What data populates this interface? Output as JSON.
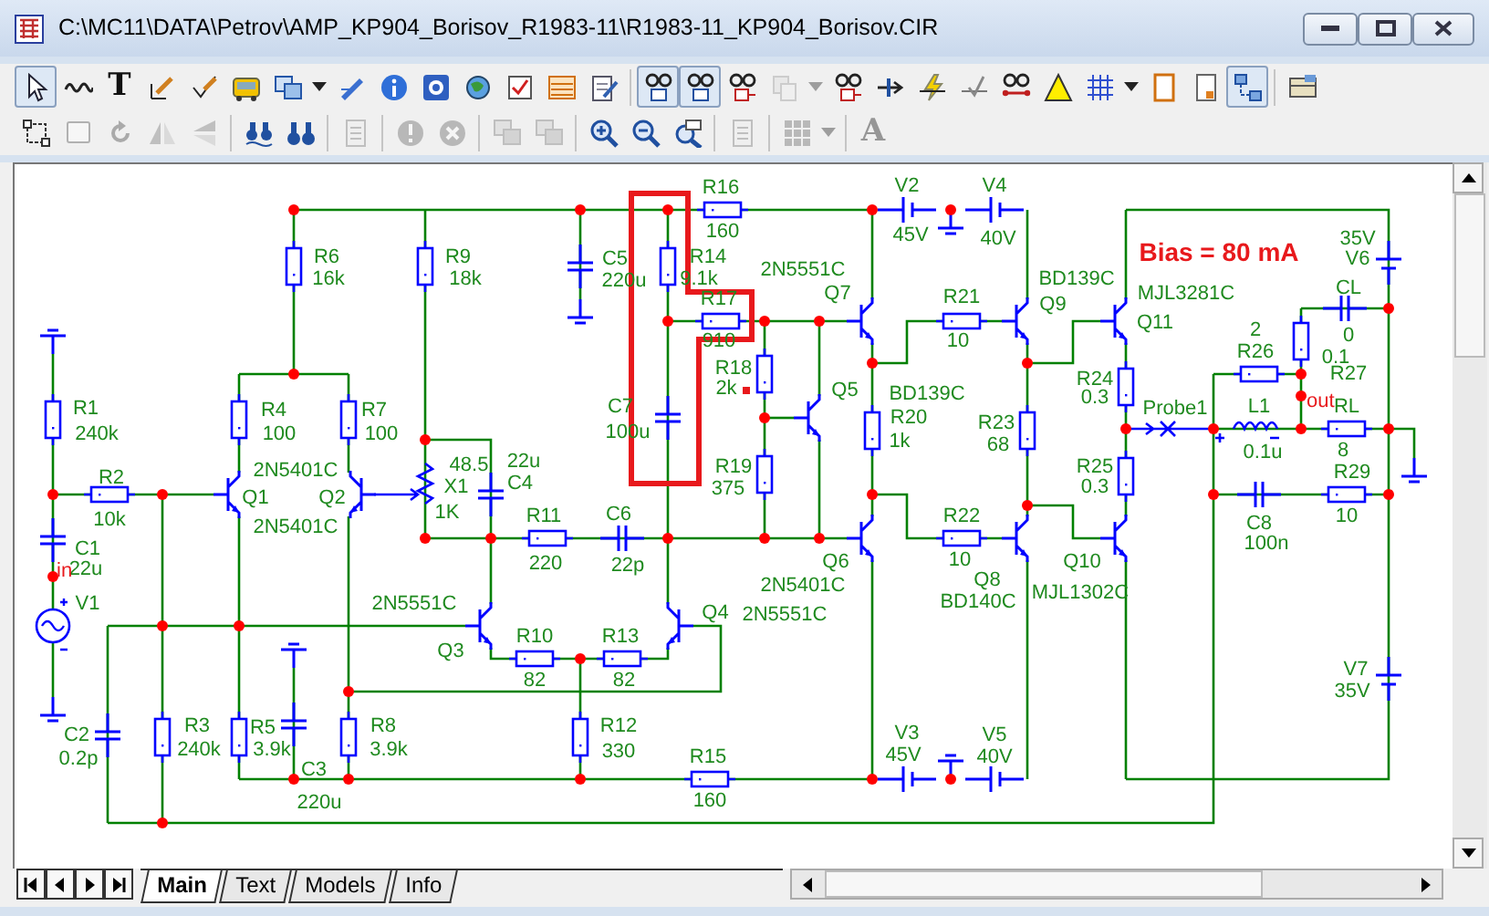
{
  "window": {
    "title": "C:\\MC11\\DATA\\Petrov\\AMP_KP904_Borisov_R1983-11\\R1983-11_KP904_Borisov.CIR"
  },
  "toolbar_1": [
    {
      "pressed": true,
      "disabled": false
    },
    {
      "pressed": false,
      "disabled": false
    },
    {
      "pressed": false,
      "disabled": false,
      "glyph": "T"
    },
    {
      "pressed": false,
      "disabled": false
    },
    {
      "pressed": false,
      "disabled": false
    },
    {
      "pressed": false,
      "disabled": false
    },
    {
      "pressed": false,
      "disabled": false
    },
    {
      "pressed": false,
      "disabled": false
    },
    {
      "pressed": false,
      "disabled": false
    },
    {
      "pressed": false,
      "disabled": false
    },
    {
      "pressed": false,
      "disabled": false
    },
    {
      "pressed": false,
      "disabled": false
    },
    {
      "pressed": false,
      "disabled": false
    },
    {
      "pressed": false,
      "disabled": false
    },
    {
      "pressed": false,
      "disabled": false
    },
    {
      "pressed": true,
      "disabled": false
    },
    {
      "pressed": true,
      "disabled": false
    },
    {
      "pressed": false,
      "disabled": false
    },
    {
      "pressed": false,
      "disabled": true
    },
    {
      "pressed": false,
      "disabled": true
    },
    {
      "pressed": false,
      "disabled": false
    },
    {
      "pressed": false,
      "disabled": false
    },
    {
      "pressed": false,
      "disabled": false
    },
    {
      "pressed": false,
      "disabled": false
    },
    {
      "pressed": false,
      "disabled": false
    },
    {
      "pressed": false,
      "disabled": false
    },
    {
      "pressed": false,
      "disabled": false
    },
    {
      "pressed": false,
      "disabled": false
    },
    {
      "pressed": false,
      "disabled": false
    },
    {
      "pressed": false,
      "disabled": false
    },
    {
      "pressed": true,
      "disabled": false
    },
    {
      "pressed": false,
      "disabled": false
    }
  ],
  "toolbar_2": [
    {
      "pressed": false,
      "disabled": false
    },
    {
      "pressed": false,
      "disabled": true
    },
    {
      "pressed": false,
      "disabled": true
    },
    {
      "pressed": false,
      "disabled": true
    },
    {
      "pressed": false,
      "disabled": true
    },
    {
      "pressed": false,
      "disabled": false
    },
    {
      "pressed": false,
      "disabled": false
    },
    {
      "pressed": false,
      "disabled": true
    },
    {
      "pressed": false,
      "disabled": true
    },
    {
      "pressed": false,
      "disabled": true
    },
    {
      "pressed": false,
      "disabled": true
    },
    {
      "pressed": false,
      "disabled": true
    },
    {
      "pressed": false,
      "disabled": false
    },
    {
      "pressed": false,
      "disabled": false
    },
    {
      "pressed": false,
      "disabled": false
    },
    {
      "pressed": false,
      "disabled": true
    },
    {
      "pressed": false,
      "disabled": true
    },
    {
      "pressed": false,
      "disabled": true
    },
    {
      "pressed": false,
      "disabled": true,
      "glyph": "A"
    }
  ],
  "schematic": {
    "labels": [
      "R16",
      "V2",
      "V4",
      "160",
      "45V",
      "40V",
      "R6",
      "R9",
      "C5",
      "R14",
      "2N5551C",
      "16k",
      "18k",
      "220u",
      "9.1k",
      "BD139C",
      "R17",
      "Q7",
      "R21",
      "Q9",
      "MJL3281C",
      "35V",
      "V6",
      "CL",
      "910",
      "10",
      "Q11",
      "2",
      "R26",
      "0",
      "0.1",
      "R18",
      "R24",
      "R27",
      "2k",
      "Q5",
      "BD139C",
      "0.3",
      "R1",
      "R4",
      "R7",
      "C7",
      "Probe1",
      "L1",
      "RL",
      "R20",
      "R23",
      "240k",
      "100",
      "100",
      "100u",
      "1k",
      "68",
      "0.1u",
      "8",
      "R2",
      "2N5401C",
      "48.5",
      "22u",
      "R19",
      "R25",
      "R29",
      "X1",
      "C4",
      "375",
      "0.3",
      "Q1",
      "Q2",
      "10k",
      "1K",
      "R11",
      "C6",
      "R22",
      "C8",
      "10",
      "2N5401C",
      "C1",
      "100n",
      "22u",
      "220",
      "22p",
      "Q6",
      "10",
      "Q10",
      "2N5401C",
      "Q8",
      "MJL1302C",
      "V1",
      "2N5551C",
      "BD140C",
      "Q4",
      "2N5551C",
      "R10",
      "R13",
      "Q3",
      "V7",
      "82",
      "82",
      "35V",
      "C2",
      "R3",
      "R5",
      "R8",
      "R12",
      "V3",
      "V5",
      "0.2p",
      "240k",
      "3.9k",
      "3.9k",
      "330",
      "R15",
      "45V",
      "40V",
      "C3",
      "220u",
      "160"
    ],
    "annotation": "Bias = 80 mA",
    "node_labels": [
      "in",
      "out"
    ]
  },
  "sheet_tabs": [
    {
      "label": "Main",
      "selected": true
    },
    {
      "label": "Text",
      "selected": false
    },
    {
      "label": "Models",
      "selected": false
    },
    {
      "label": "Info",
      "selected": false
    }
  ]
}
